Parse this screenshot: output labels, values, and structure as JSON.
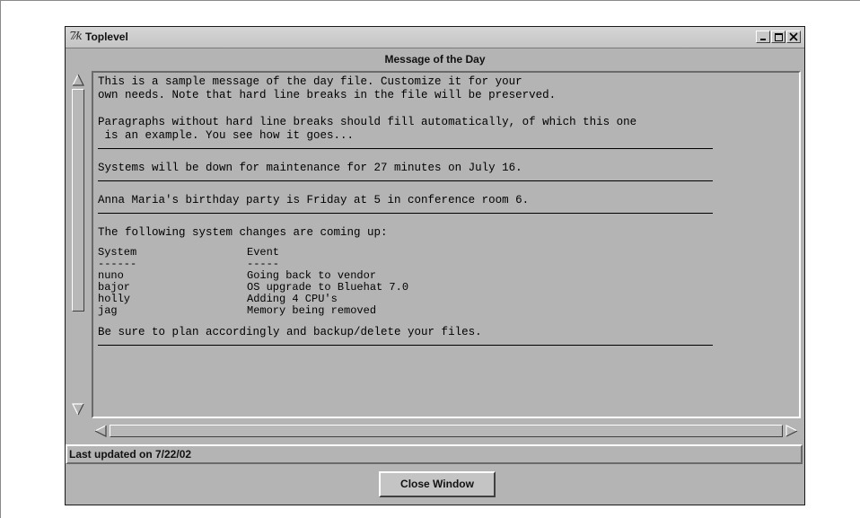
{
  "window": {
    "title": "Toplevel",
    "app_icon": "tk-feather-icon"
  },
  "heading": "Message of the Day",
  "message": {
    "para1": [
      "This is a sample message of the day file. Customize it for your",
      "own needs. Note that hard line breaks in the file will be preserved."
    ],
    "para2": [
      "Paragraphs without hard line breaks should fill automatically, of which this one",
      " is an example. You see how it goes..."
    ],
    "notice1": "Systems will be down for maintenance for 27 minutes on July 16.",
    "notice2": "Anna Maria's birthday party is Friday at 5 in conference room 6.",
    "changes_intro": "The following system changes are coming up:",
    "table": {
      "headers": [
        "System",
        "Event"
      ],
      "underline": [
        "------",
        "-----"
      ],
      "rows": [
        [
          "nuno",
          "Going back to vendor"
        ],
        [
          "bajor",
          "OS upgrade to Bluehat 7.0"
        ],
        [
          "holly",
          "Adding 4 CPU's"
        ],
        [
          "jag",
          "Memory being removed"
        ]
      ]
    },
    "closing": "Be sure to plan accordingly and backup/delete your files."
  },
  "status": "Last updated on 7/22/02",
  "buttons": {
    "close": "Close Window"
  }
}
